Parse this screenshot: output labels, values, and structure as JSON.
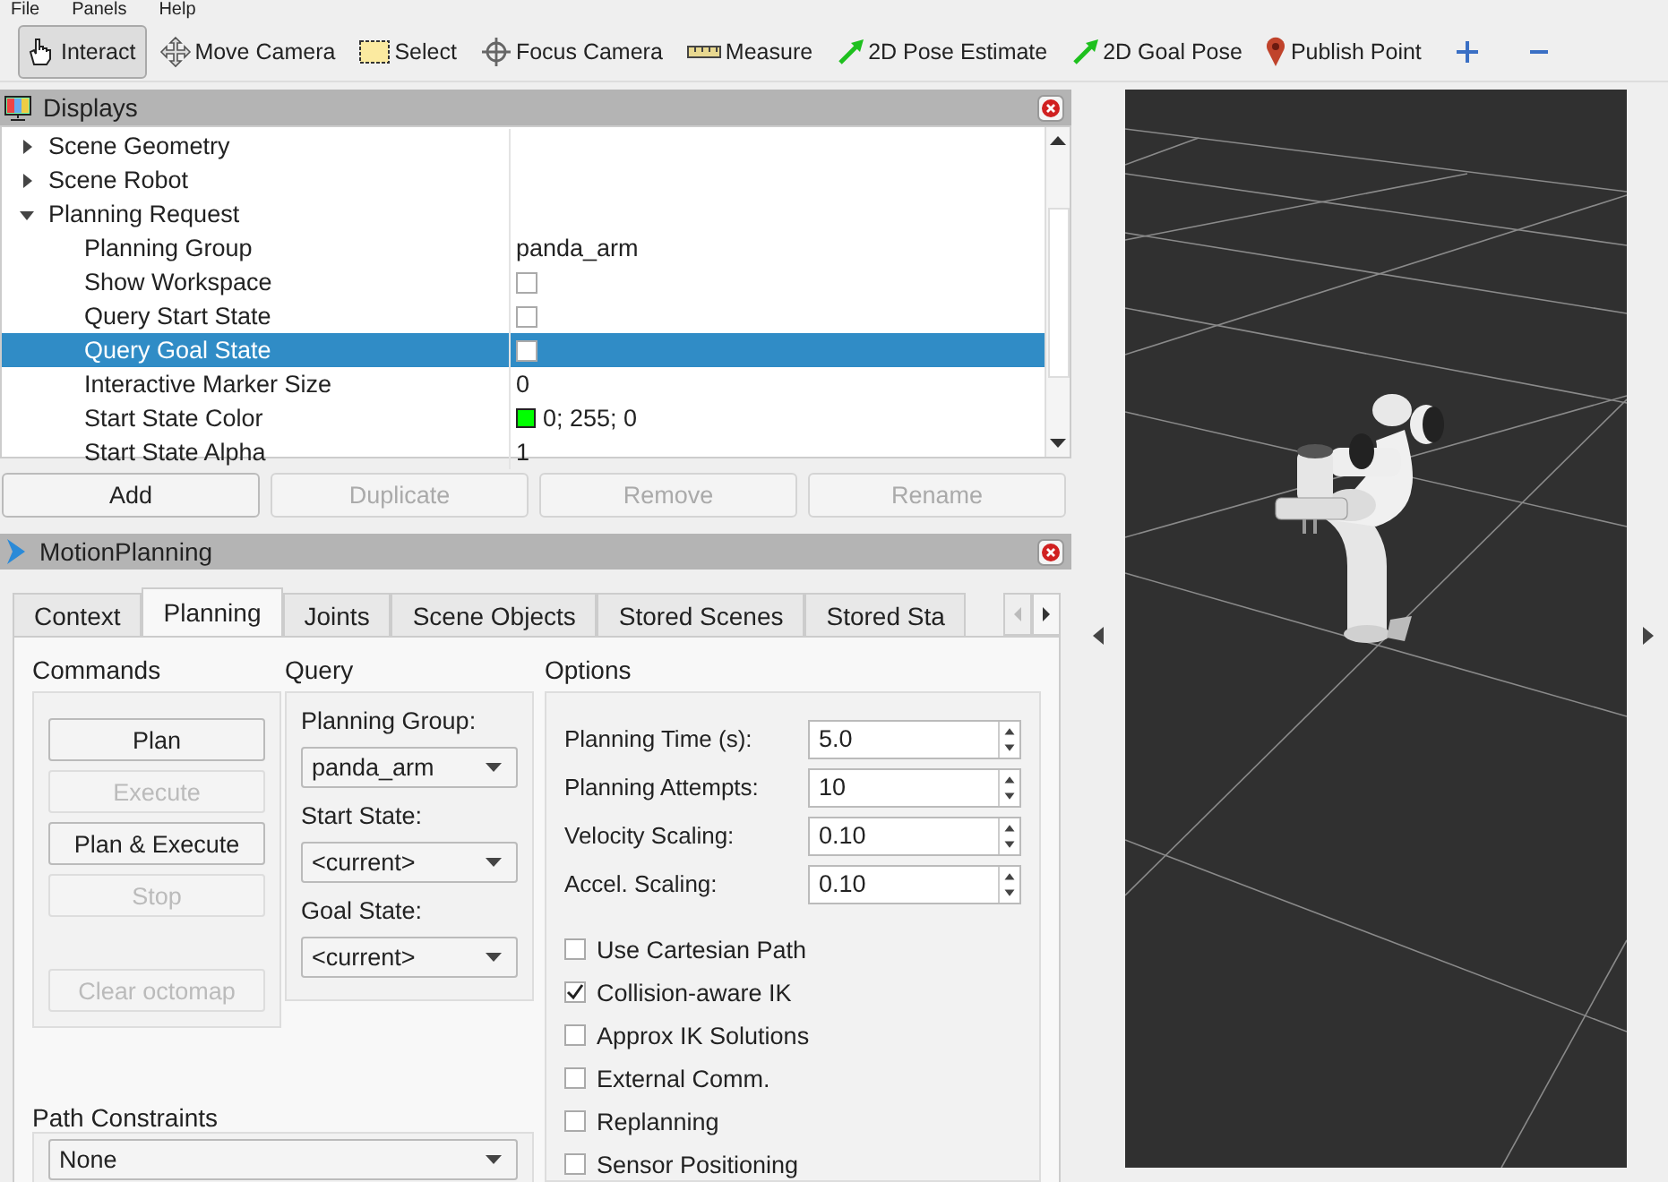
{
  "menu": [
    "File",
    "Panels",
    "Help"
  ],
  "toolbar": [
    {
      "label": "Interact",
      "selected": true
    },
    {
      "label": "Move Camera",
      "selected": false
    },
    {
      "label": "Select",
      "selected": false
    },
    {
      "label": "Focus Camera",
      "selected": false
    },
    {
      "label": "Measure",
      "selected": false
    },
    {
      "label": "2D Pose Estimate",
      "selected": false
    },
    {
      "label": "2D Goal Pose",
      "selected": false
    },
    {
      "label": "Publish Point",
      "selected": false
    }
  ],
  "displays": {
    "title": "Displays",
    "tree": [
      {
        "label": "Scene Geometry",
        "expanded": false,
        "selected": false
      },
      {
        "label": "Scene Robot",
        "expanded": false,
        "selected": false
      },
      {
        "label": "Planning Request",
        "expanded": true,
        "selected": false,
        "children": [
          {
            "kind": "text",
            "label": "Planning Group",
            "value": "panda_arm",
            "selected": false
          },
          {
            "kind": "checkbox",
            "label": "Show Workspace",
            "checked": false,
            "selected": false
          },
          {
            "kind": "checkbox",
            "label": "Query Start State",
            "checked": false,
            "selected": false
          },
          {
            "kind": "checkbox",
            "label": "Query Goal State",
            "checked": false,
            "selected": true
          },
          {
            "kind": "text",
            "label": "Interactive Marker Size",
            "value": "0",
            "selected": false
          },
          {
            "kind": "color",
            "label": "Start State Color",
            "value": "0; 255; 0",
            "color": "#00ff00",
            "selected": false
          },
          {
            "kind": "text",
            "label": "Start State Alpha",
            "value": "1",
            "selected": false
          }
        ]
      }
    ],
    "buttons": [
      {
        "label": "Add",
        "disabled": false
      },
      {
        "label": "Duplicate",
        "disabled": true
      },
      {
        "label": "Remove",
        "disabled": true
      },
      {
        "label": "Rename",
        "disabled": true
      }
    ]
  },
  "motion_planning": {
    "title": "MotionPlanning",
    "tabs": [
      {
        "label": "Context",
        "selected": false
      },
      {
        "label": "Planning",
        "selected": true
      },
      {
        "label": "Joints",
        "selected": false
      },
      {
        "label": "Scene Objects",
        "selected": false
      },
      {
        "label": "Stored Scenes",
        "selected": false
      },
      {
        "label": "Stored Sta",
        "selected": false
      }
    ],
    "commands": {
      "title": "Commands",
      "buttons": [
        {
          "label": "Plan",
          "disabled": false
        },
        {
          "label": "Execute",
          "disabled": true
        },
        {
          "label": "Plan & Execute",
          "disabled": false
        },
        {
          "label": "Stop",
          "disabled": true
        },
        {
          "label": "Clear octomap",
          "disabled": true
        }
      ]
    },
    "query": {
      "title": "Query",
      "fields": [
        {
          "label": "Planning Group:",
          "value": "panda_arm"
        },
        {
          "label": "Start State:",
          "value": "<current>"
        },
        {
          "label": "Goal State:",
          "value": "<current>"
        }
      ]
    },
    "options": {
      "title": "Options",
      "spinners": [
        {
          "label": "Planning Time (s):",
          "value": "5.0"
        },
        {
          "label": "Planning Attempts:",
          "value": "10"
        },
        {
          "label": "Velocity Scaling:",
          "value": "0.10"
        },
        {
          "label": "Accel. Scaling:",
          "value": "0.10"
        }
      ],
      "checkboxes": [
        {
          "label": "Use Cartesian Path",
          "checked": false
        },
        {
          "label": "Collision-aware IK",
          "checked": true
        },
        {
          "label": "Approx IK Solutions",
          "checked": false
        },
        {
          "label": "External Comm.",
          "checked": false
        },
        {
          "label": "Replanning",
          "checked": false
        },
        {
          "label": "Sensor Positioning",
          "checked": false
        }
      ]
    },
    "path_constraints": {
      "title": "Path Constraints",
      "value": "None"
    }
  }
}
